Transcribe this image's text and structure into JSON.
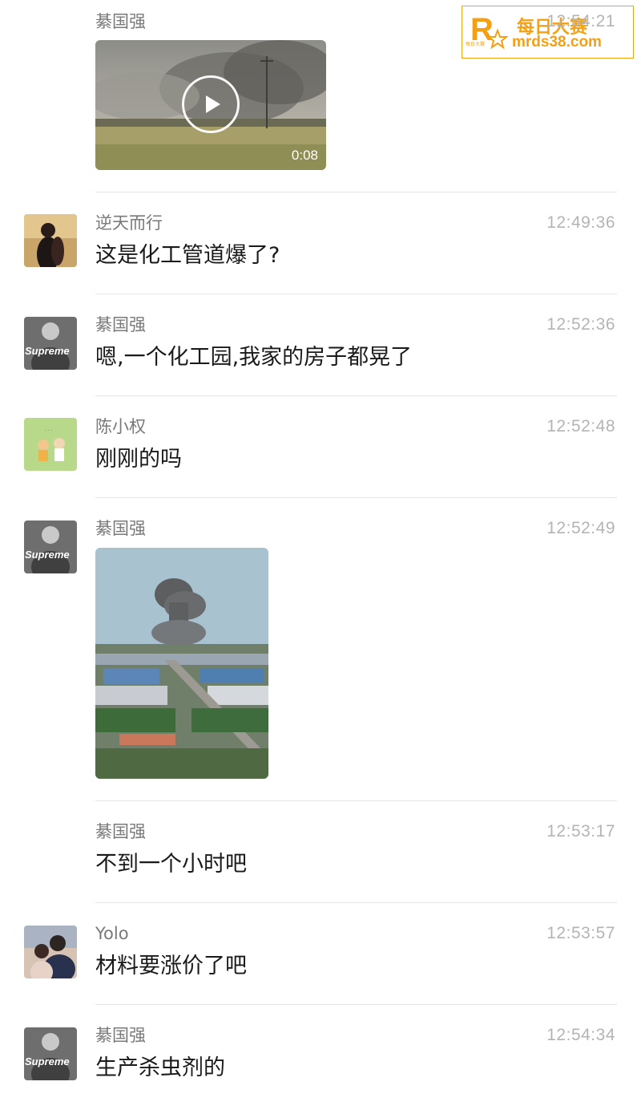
{
  "watermark": {
    "line1": "每日大赛",
    "line2": "mrds38.com",
    "small": "每日大赛",
    "brand_color": "#f4a014"
  },
  "messages": [
    {
      "sender": "綦国强",
      "time": "12:54:21",
      "type": "video",
      "duration": "0:08"
    },
    {
      "sender": "逆天而行",
      "time": "12:49:36",
      "type": "text",
      "text": "这是化工管道爆了?"
    },
    {
      "sender": "綦国强",
      "time": "12:52:36",
      "type": "text",
      "text": "嗯,一个化工园,我家的房子都晃了",
      "avatar_label": "Supreme"
    },
    {
      "sender": "陈小权",
      "time": "12:52:48",
      "type": "text",
      "text": "刚刚的吗"
    },
    {
      "sender": "綦国强",
      "time": "12:52:49",
      "type": "image",
      "avatar_label": "Supreme"
    },
    {
      "sender": "綦国强",
      "time": "12:53:17",
      "type": "text",
      "text": "不到一个小时吧"
    },
    {
      "sender": "Yolo",
      "time": "12:53:57",
      "type": "text",
      "text": "材料要涨价了吧"
    },
    {
      "sender": "綦国强",
      "time": "12:54:34",
      "type": "text",
      "text": "生产杀虫剂的",
      "avatar_label": "Supreme"
    }
  ]
}
